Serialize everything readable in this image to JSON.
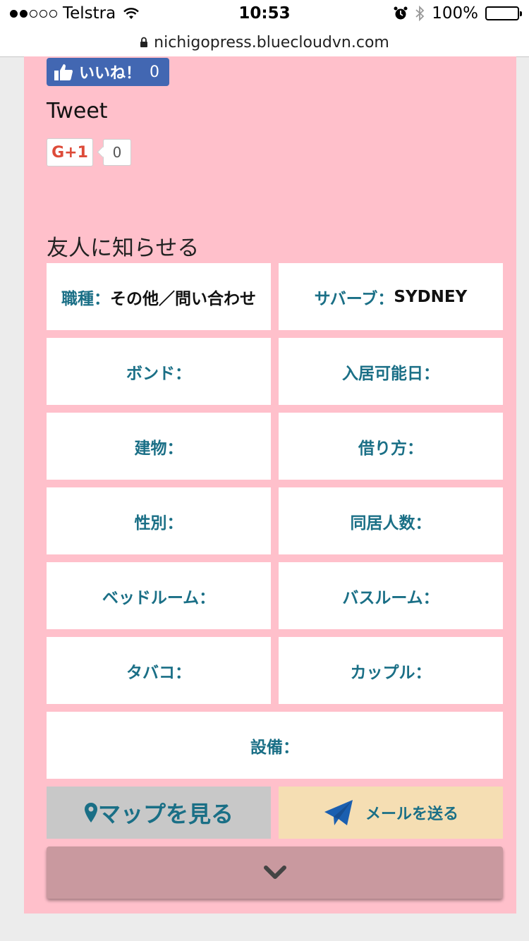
{
  "status_bar": {
    "carrier": "Telstra",
    "time": "10:53",
    "battery": "100%"
  },
  "url_bar": {
    "url": "nichigopress.bluecloudvn.com"
  },
  "social": {
    "like_label": "いいね！",
    "like_count": "0",
    "tweet_label": "Tweet",
    "gplus_label": "G+1",
    "gplus_count": "0"
  },
  "share": {
    "heading": "友人に知らせる"
  },
  "details": {
    "job": {
      "label": "職種：",
      "value": "その他／問い合わせ"
    },
    "suburb": {
      "label": "サバーブ：",
      "value": "SYDNEY"
    },
    "bond": {
      "label": "ボンド：",
      "value": ""
    },
    "move_in": {
      "label": "入居可能日：",
      "value": ""
    },
    "building": {
      "label": "建物：",
      "value": ""
    },
    "rent_type": {
      "label": "借り方：",
      "value": ""
    },
    "gender": {
      "label": "性別：",
      "value": ""
    },
    "occupants": {
      "label": "同居人数：",
      "value": ""
    },
    "bedroom": {
      "label": "ベッドルーム：",
      "value": ""
    },
    "bathroom": {
      "label": "バスルーム：",
      "value": ""
    },
    "smoking": {
      "label": "タバコ：",
      "value": ""
    },
    "couple": {
      "label": "カップル：",
      "value": ""
    },
    "facilities": {
      "label": "設備：",
      "value": ""
    }
  },
  "actions": {
    "map_label": "マップを見る",
    "mail_label": "メールを送る"
  },
  "icons": {
    "like": "thumbs-up-icon",
    "map": "map-pin-icon",
    "mail": "paper-plane-icon",
    "expand": "chevron-down-icon"
  },
  "colors": {
    "card_bg": "#ffc0cb",
    "label_teal": "#1a6f86",
    "fb_blue": "#4267b2",
    "mail_bg": "#f5deb3",
    "expand_bg": "#c9999f"
  }
}
